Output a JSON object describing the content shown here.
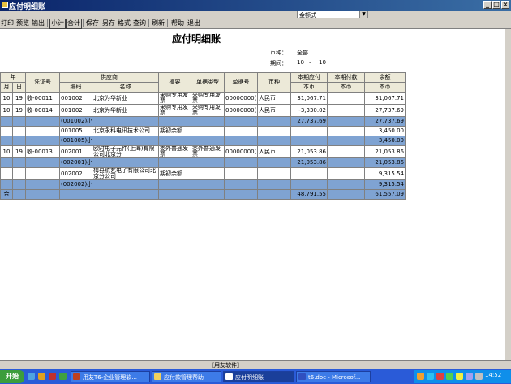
{
  "window": {
    "title": "应付明细账",
    "min": "_",
    "max": "□",
    "close": "×"
  },
  "combo": {
    "value": "金额式",
    "arrow": "▼"
  },
  "toolbar": {
    "print": "打印",
    "preview": "预览",
    "export": "输出",
    "subtotal": "小计",
    "total": "合计",
    "save": "保存",
    "saveas": "另存",
    "format": "格式",
    "query": "查询",
    "refresh": "刷新",
    "help": "帮助",
    "exit": "退出"
  },
  "report": {
    "title": "应付明细账",
    "currency_label": "币种：",
    "currency_value": "全部",
    "period_label": "期间：",
    "period_from": "10",
    "period_dash": "-",
    "period_to": "10"
  },
  "headers": {
    "year": "年",
    "month": "月",
    "day": "日",
    "voucher": "凭证号",
    "supplier": "供应商",
    "code": "编码",
    "name": "名称",
    "summary": "摘要",
    "doctype": "单据类型",
    "docno": "单据号",
    "currency": "币种",
    "payable": "本期应付",
    "payable_sub": "本币",
    "paid": "本期付款",
    "paid_sub": "本币",
    "balance": "余额",
    "balance_sub": "本币"
  },
  "rows": [
    {
      "type": "detail",
      "m": "10",
      "d": "19",
      "voucher": "收-00011",
      "code": "001002",
      "name": "北京为华新业",
      "summary": "采购专用发票",
      "doctype": "采购专用发票",
      "docno": "00000000(",
      "cur": "人民币",
      "payable": "31,067.71",
      "paid": "",
      "balance": "31,067.71"
    },
    {
      "type": "detail",
      "m": "10",
      "d": "19",
      "voucher": "收-00014",
      "code": "001002",
      "name": "北京为华新业",
      "summary": "采购专用发票",
      "doctype": "采购专用发票",
      "docno": "00000000(",
      "cur": "人民币",
      "payable": "-3,330.02",
      "paid": "",
      "balance": "27,737.69"
    },
    {
      "type": "sub",
      "m": "",
      "d": "",
      "voucher": "",
      "code": "(001002)小计:",
      "name": "",
      "summary": "",
      "doctype": "",
      "docno": "",
      "cur": "",
      "payable": "27,737.69",
      "paid": "",
      "balance": "27,737.69"
    },
    {
      "type": "detail",
      "m": "",
      "d": "",
      "voucher": "",
      "code": "001005",
      "name": "北京永科电讯技术公司",
      "summary": "期初余额",
      "doctype": "",
      "docno": "",
      "cur": "",
      "payable": "",
      "paid": "",
      "balance": "3,450.00"
    },
    {
      "type": "sub",
      "m": "",
      "d": "",
      "voucher": "",
      "code": "(001005)小计:",
      "name": "",
      "summary": "",
      "doctype": "",
      "docno": "",
      "cur": "",
      "payable": "",
      "paid": "",
      "balance": "3,450.00"
    },
    {
      "type": "detail",
      "m": "10",
      "d": "19",
      "voucher": "收-00013",
      "code": "002001",
      "name": "欧时电子元件(上海)有限公司北京分",
      "summary": "委外普通发票",
      "doctype": "委外普通发票",
      "docno": "00000000(",
      "cur": "人民币",
      "payable": "21,053.86",
      "paid": "",
      "balance": "21,053.86"
    },
    {
      "type": "sub",
      "m": "",
      "d": "",
      "voucher": "",
      "code": "(002001)小计:",
      "name": "",
      "summary": "",
      "doctype": "",
      "docno": "",
      "cur": "",
      "payable": "21,053.86",
      "paid": "",
      "balance": "21,053.86"
    },
    {
      "type": "detail",
      "m": "",
      "d": "",
      "voucher": "",
      "code": "002002",
      "name": "梅县统艺电子有限公司北京分公司",
      "summary": "期初余额",
      "doctype": "",
      "docno": "",
      "cur": "",
      "payable": "",
      "paid": "",
      "balance": "9,315.54"
    },
    {
      "type": "sub",
      "m": "",
      "d": "",
      "voucher": "",
      "code": "(002002)小计:",
      "name": "",
      "summary": "",
      "doctype": "",
      "docno": "",
      "cur": "",
      "payable": "",
      "paid": "",
      "balance": "9,315.54"
    },
    {
      "type": "total",
      "m": "合",
      "d": "",
      "voucher": "",
      "code": "",
      "name": "",
      "summary": "",
      "doctype": "",
      "docno": "",
      "cur": "",
      "payable": "48,791.55",
      "paid": "",
      "balance": "61,557.09"
    }
  ],
  "status": {
    "text": "【用友软件】"
  },
  "taskbar": {
    "start": "开始",
    "task1": "用友T6-企业管理软...",
    "task2": "应付款管理帮助",
    "task3": "应付明细账",
    "task4": "t6.doc - Microsof...",
    "clock": "14:52"
  },
  "colors": {
    "titlebar": "#0a246a",
    "subtotal": "#7fa3d2",
    "taskbar": "#2a5bd8"
  }
}
